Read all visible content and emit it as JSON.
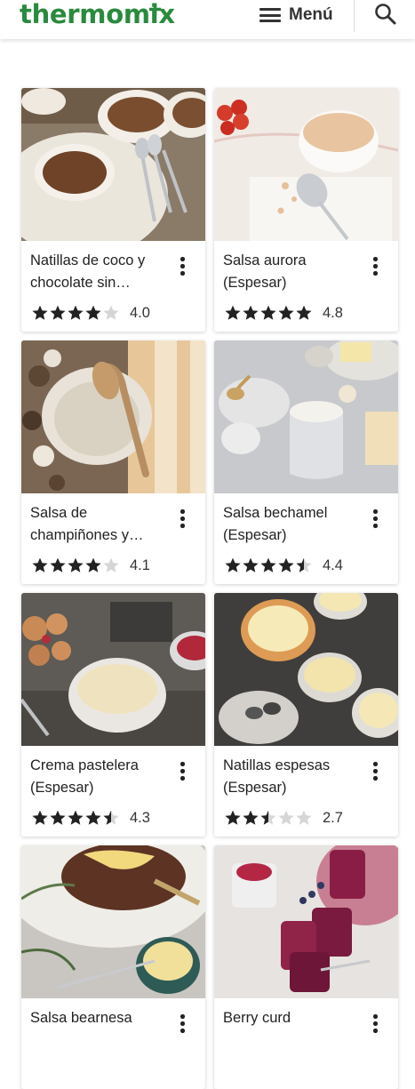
{
  "header": {
    "logo_text": "thermomix",
    "menu_label": "Menú",
    "icons": [
      "hamburger-menu-icon",
      "search-icon"
    ]
  },
  "colors": {
    "brand": "#2a8a3e",
    "star_filled": "#222222",
    "star_empty": "#d6d6d6"
  },
  "recipes": [
    {
      "title": "Natillas de coco y chocolate sin…",
      "rating": "4.0",
      "rating_value": 4.0,
      "image": "chocolate-custard-bowls"
    },
    {
      "title": "Salsa aurora\n(Espesar)",
      "rating": "4.8",
      "rating_value": 4.8,
      "image": "aurora-sauce-bowl"
    },
    {
      "title": "Salsa de\nchampiñones y…",
      "rating": "4.1",
      "rating_value": 4.1,
      "image": "mushroom-sauce-plate"
    },
    {
      "title": "Salsa bechamel\n(Espesar)",
      "rating": "4.4",
      "rating_value": 4.4,
      "image": "bechamel-pot"
    },
    {
      "title": "Crema pastelera\n(Espesar)",
      "rating": "4.3",
      "rating_value": 4.3,
      "image": "pastry-cream-bowl"
    },
    {
      "title": "Natillas espesas\n(Espesar)",
      "rating": "2.7",
      "rating_value": 2.7,
      "image": "thick-custard-bowls"
    },
    {
      "title": "Salsa bearnesa",
      "rating": "",
      "rating_value": null,
      "image": "bearnaise-steak"
    },
    {
      "title": "Berry curd",
      "rating": "",
      "rating_value": null,
      "image": "berry-curd-jars"
    }
  ]
}
